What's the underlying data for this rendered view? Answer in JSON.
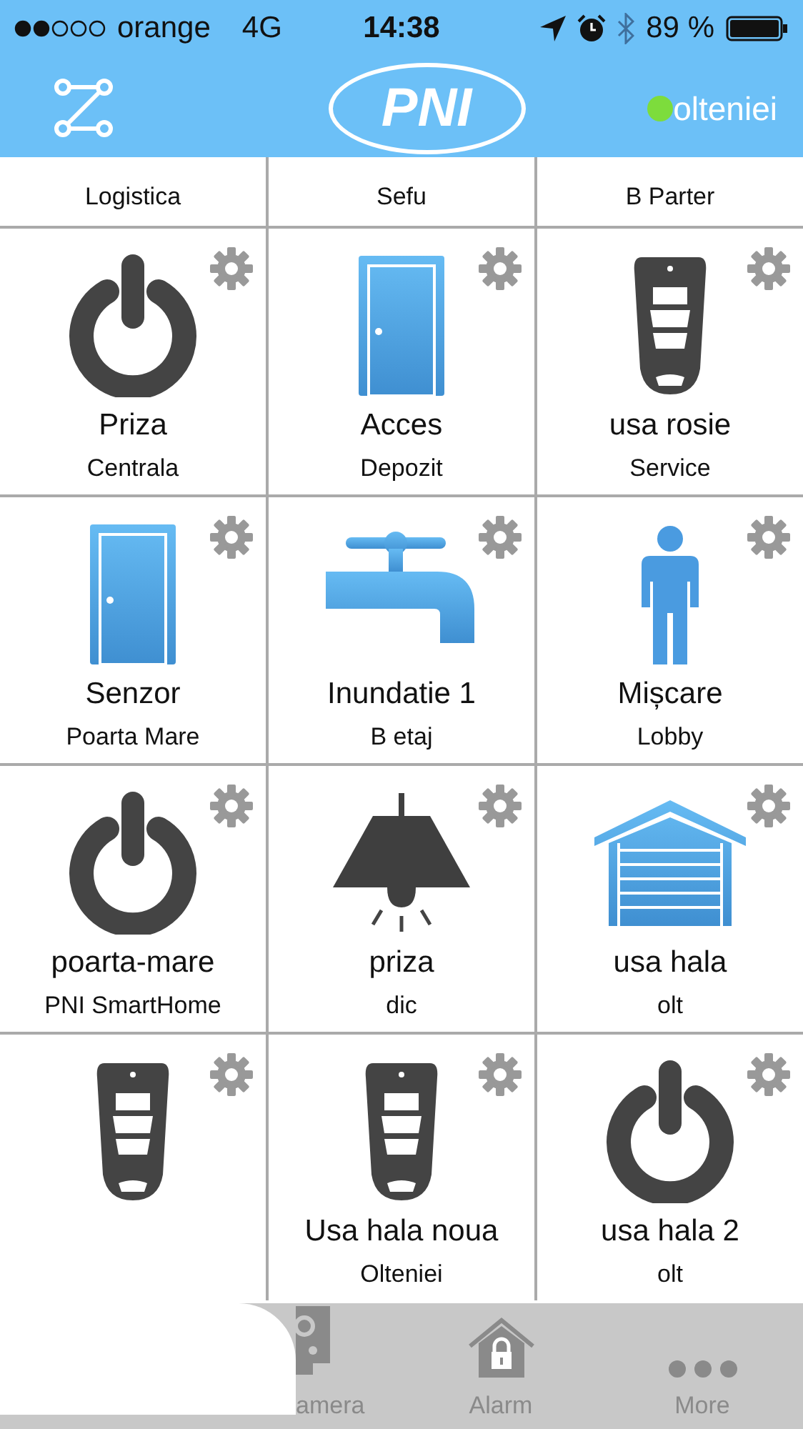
{
  "status_bar": {
    "carrier": "orange",
    "network": "4G",
    "time": "14:38",
    "battery": "89 %"
  },
  "header": {
    "logo": "PNI",
    "location": {
      "name": "olteniei",
      "color": "#7ddc3c"
    }
  },
  "partial_row": [
    {
      "subtitle": "Logistica"
    },
    {
      "subtitle": "Sefu"
    },
    {
      "subtitle": "B Parter"
    }
  ],
  "devices": [
    {
      "kind": "power",
      "name": "Priza",
      "subtitle": "Centrala"
    },
    {
      "kind": "door",
      "name": "Acces",
      "subtitle": "Depozit"
    },
    {
      "kind": "remote",
      "name": "usa rosie",
      "subtitle": "Service"
    },
    {
      "kind": "door",
      "name": "Senzor",
      "subtitle": "Poarta Mare"
    },
    {
      "kind": "faucet",
      "name": "Inundatie 1",
      "subtitle": "B etaj"
    },
    {
      "kind": "person",
      "name": "Mișcare",
      "subtitle": "Lobby"
    },
    {
      "kind": "power",
      "name": "poarta-mare",
      "subtitle": "PNI SmartHome"
    },
    {
      "kind": "lamp",
      "name": "priza",
      "subtitle": "dic"
    },
    {
      "kind": "garage",
      "name": "usa hala",
      "subtitle": "olt"
    },
    {
      "kind": "remote"
    },
    {
      "kind": "remote",
      "name": "Usa hala noua",
      "subtitle": "Olteniei"
    },
    {
      "kind": "power",
      "name": "usa hala 2",
      "subtitle": "olt"
    }
  ],
  "tab_bar": [
    {
      "kind": "camera",
      "label": "amera"
    },
    {
      "kind": "alarm",
      "label": "Alarm"
    },
    {
      "kind": "more",
      "label": "More"
    }
  ]
}
